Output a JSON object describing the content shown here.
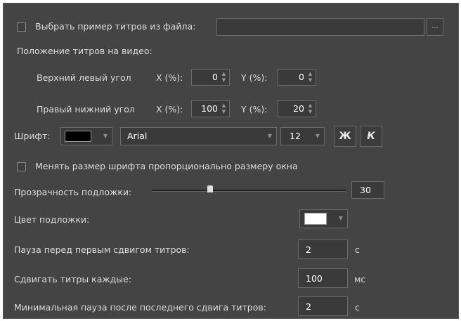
{
  "file": {
    "checkbox_label": "Выбрать пример титров из файла:",
    "path_value": "",
    "browse_label": "..."
  },
  "position": {
    "section_label": "Положение титров на видео:",
    "top_left": {
      "label": "Верхний левый угол",
      "x_label": "X (%):",
      "x_value": "0",
      "y_label": "Y (%):",
      "y_value": "0"
    },
    "bottom_right": {
      "label": "Правый нижний угол",
      "x_label": "X (%):",
      "x_value": "100",
      "y_label": "Y (%):",
      "y_value": "20"
    }
  },
  "font": {
    "label": "Шрифт:",
    "color": "#000000",
    "family": "Arial",
    "size": "12",
    "bold_label": "Ж",
    "italic_label": "К"
  },
  "resize_checkbox_label": "Менять размер шрифта пропорционально размеру окна",
  "opacity": {
    "label": "Прозрачность подложки:",
    "value": "30",
    "slider_fraction": 0.3
  },
  "bg_color": {
    "label": "Цвет подложки:",
    "color": "#ffffff"
  },
  "pause_first": {
    "label": "Пауза перед первым сдвигом титров:",
    "value": "2",
    "unit": "с"
  },
  "shift_every": {
    "label": "Сдвигать титры каждые:",
    "value": "100",
    "unit": "мс"
  },
  "pause_last": {
    "label": "Минимальная пауза после последнего сдвига титров:",
    "value": "2",
    "unit": "с"
  }
}
